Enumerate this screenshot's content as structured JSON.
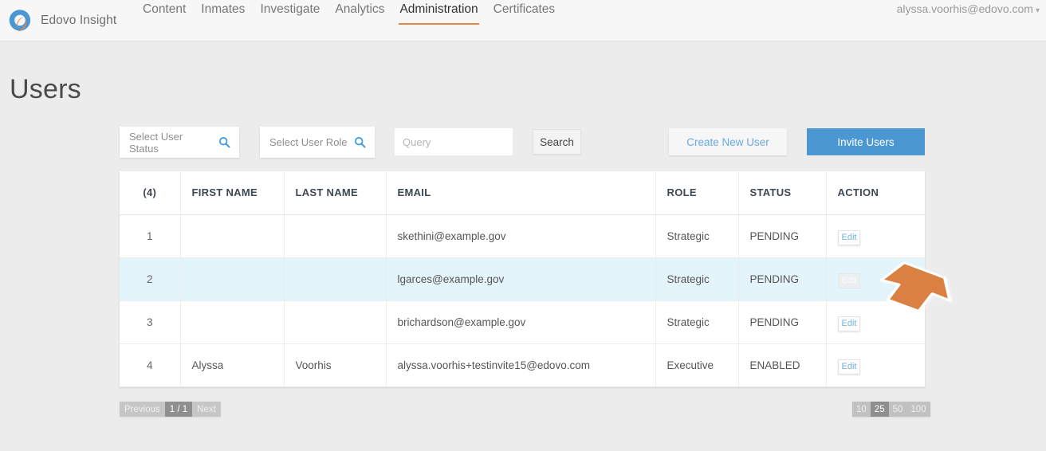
{
  "header": {
    "brand_name": "Edovo Insight",
    "logo_icon": "edovo-circle-swoosh-logo",
    "nav": [
      {
        "label": "Content",
        "active": false
      },
      {
        "label": "Inmates",
        "active": false
      },
      {
        "label": "Investigate",
        "active": false
      },
      {
        "label": "Analytics",
        "active": false
      },
      {
        "label": "Administration",
        "active": true
      },
      {
        "label": "Certificates",
        "active": false
      }
    ],
    "account_email": "alyssa.voorhis@edovo.com",
    "account_caret_icon": "chevron-down-icon",
    "active_underline_color": "#e08843"
  },
  "page": {
    "title": "Users",
    "background_color": "#ececec"
  },
  "toolbar": {
    "status_filter_placeholder": "Select User Status",
    "role_filter_placeholder": "Select User Role",
    "search_icon": "magnifier-icon",
    "query_placeholder": "Query",
    "query_value": "",
    "search_label": "Search",
    "create_user_label": "Create New User",
    "create_user_color": "#6aaade",
    "invite_users_label": "Invite Users",
    "invite_users_color": "#4a97d2"
  },
  "table": {
    "columns": [
      "(4)",
      "FIRST NAME",
      "LAST NAME",
      "EMAIL",
      "ROLE",
      "STATUS",
      "ACTION"
    ],
    "rows": [
      {
        "num": "1",
        "first_name": "",
        "last_name": "",
        "email": "skethini@example.gov",
        "role": "Strategic",
        "status": "PENDING",
        "action": "Edit",
        "highlighted": false,
        "action_muted": false
      },
      {
        "num": "2",
        "first_name": "",
        "last_name": "",
        "email": "lgarces@example.gov",
        "role": "Strategic",
        "status": "PENDING",
        "action": "Edit",
        "highlighted": true,
        "action_muted": true
      },
      {
        "num": "3",
        "first_name": "",
        "last_name": "",
        "email": "brichardson@example.gov",
        "role": "Strategic",
        "status": "PENDING",
        "action": "Edit",
        "highlighted": false,
        "action_muted": false
      },
      {
        "num": "4",
        "first_name": "Alyssa",
        "last_name": "Voorhis",
        "email": "alyssa.voorhis+testinvite15@edovo.com",
        "role": "Executive",
        "status": "ENABLED",
        "action": "Edit",
        "highlighted": false,
        "action_muted": false
      }
    ],
    "highlight_color": "#e4f4fb"
  },
  "pagination": {
    "previous_label": "Previous",
    "page_indicator": "1 / 1",
    "next_label": "Next",
    "page_sizes": [
      "10",
      "25",
      "50",
      "100"
    ],
    "page_size_selected": "25"
  },
  "annotation": {
    "arrow_icon": "arrow-pointer-up-left",
    "arrow_color": "#d98042",
    "points_at": "Edit"
  }
}
